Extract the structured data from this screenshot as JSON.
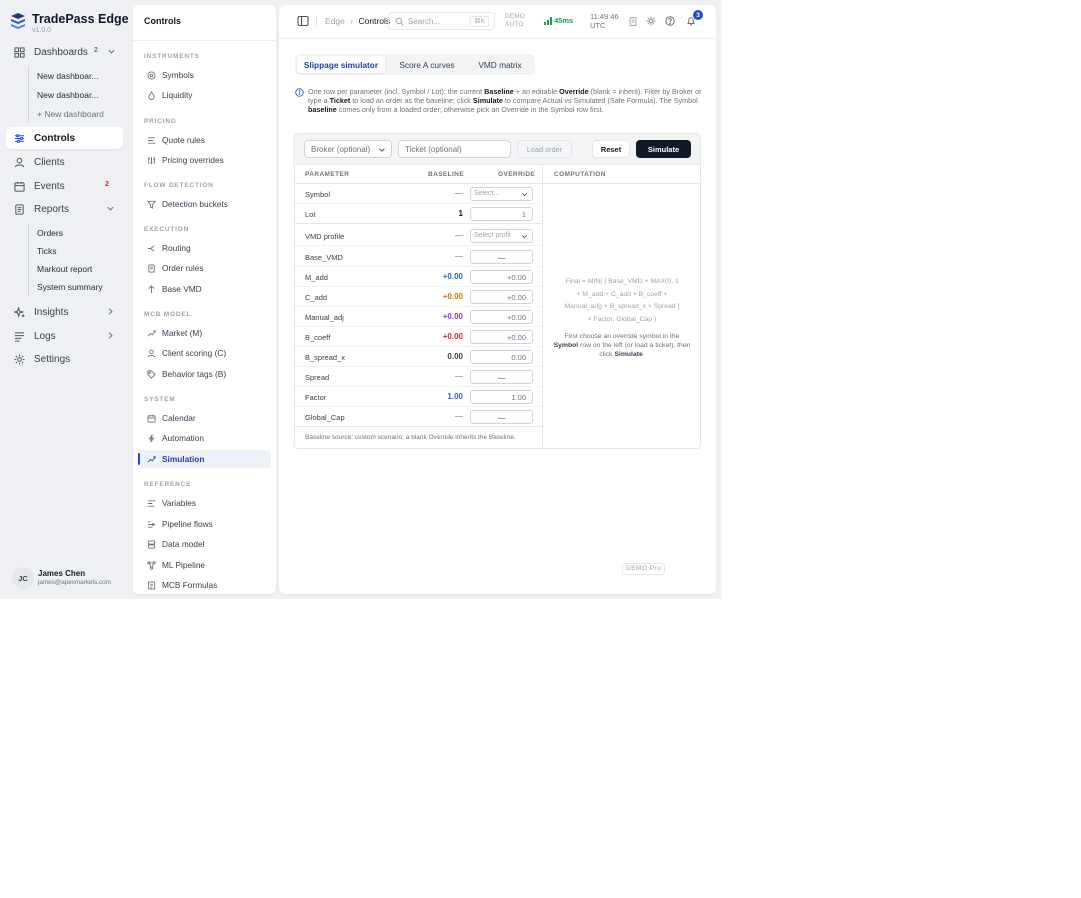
{
  "app": {
    "name": "TradePass Edge",
    "version": "v1.0.0",
    "accent": "#1d4ed8"
  },
  "nav": {
    "dashboards": {
      "label": "Dashboards",
      "count": "2",
      "icon": "grid-icon"
    },
    "dashboard_items": [
      "New dashboar...",
      "New dashboar...",
      "+ New dashboard"
    ],
    "controls": {
      "label": "Controls",
      "icon": "sliders-icon"
    },
    "clients": {
      "label": "Clients",
      "icon": "user-icon"
    },
    "events": {
      "label": "Events",
      "count": "2",
      "icon": "calendar-icon"
    },
    "reports": {
      "label": "Reports",
      "icon": "document-icon"
    },
    "report_items": [
      "Orders",
      "Ticks",
      "Markout report",
      "System summary"
    ],
    "insights": {
      "label": "Insights",
      "icon": "sparkle-icon"
    },
    "logs": {
      "label": "Logs",
      "icon": "list-icon"
    },
    "settings": {
      "label": "Settings",
      "icon": "gear-icon"
    }
  },
  "user": {
    "initials": "JC",
    "name": "James Chen",
    "email": "james@apexmarkets.com"
  },
  "controls_panel": {
    "title": "Controls",
    "sections": {
      "instruments": "INSTRUMENTS",
      "pricing": "PRICING",
      "flow_detection": "FLOW DETECTION",
      "execution": "EXECUTION",
      "mcb_model": "MCB MODEL",
      "system": "SYSTEM",
      "reference": "REFERENCE"
    },
    "items": {
      "symbols": "Symbols",
      "liquidity": "Liquidity",
      "quote_rules": "Quote rules",
      "pricing_overrides": "Pricing overrides",
      "detection_buckets": "Detection buckets",
      "routing": "Routing",
      "order_rules": "Order rules",
      "base_vmd": "Base VMD",
      "market": "Market (M)",
      "client_scoring": "Client scoring (C)",
      "behavior_tags": "Behavior tags (B)",
      "calendar": "Calendar",
      "automation": "Automation",
      "simulation": "Simulation",
      "variables": "Variables",
      "pipeline_flows": "Pipeline flows",
      "data_model": "Data model",
      "ml_pipeline": "ML Pipeline",
      "mcb_formulas": "MCB Formulas"
    }
  },
  "topbar": {
    "crumb_root": "Edge",
    "crumb_sep": "›",
    "crumb_current": "Controls",
    "search_placeholder": "Search...",
    "search_kbd": "⌘K",
    "mode_line1": "DEMO ·",
    "mode_line2": "AUTO",
    "latency": "45ms",
    "time": "11:49:46",
    "timezone": "UTC",
    "notif_count": "3"
  },
  "tabs": [
    "Slippage simulator",
    "Score A curves",
    "VMD matrix"
  ],
  "info": {
    "t1": "One row per parameter (incl. Symbol / Lot): the current ",
    "b1": "Baseline",
    "t2": " + an editable ",
    "b2": "Override",
    "t3": " (blank = inherit). Filter by Broker or type a ",
    "b3": "Ticket",
    "t4": " to load an order as the baseline; click ",
    "b4": "Simulate",
    "t5": " to compare Actual vs Simulated (Safe Formula). The Symbol ",
    "b5": "baseline",
    "t6": " comes only from a loaded order; otherwise pick an Override in the Symbol row first."
  },
  "form": {
    "broker_placeholder": "Broker (optional)",
    "ticket_placeholder": "Ticket (optional)",
    "load_label": "Load order",
    "reset_label": "Reset",
    "simulate_label": "Simulate"
  },
  "table": {
    "headers": {
      "parameter": "PARAMETER",
      "baseline": "BASELINE",
      "override": "OVERRIDE",
      "computation": "COMPUTATION"
    },
    "rows": [
      {
        "name": "Symbol",
        "baseline": "—",
        "override": "Select...",
        "color": "#9ca3af"
      },
      {
        "name": "Lot",
        "baseline": "1",
        "override": "1",
        "color": "#111827"
      },
      {
        "name": "VMD profile",
        "baseline": "—",
        "override": "Select profil",
        "color": "#9ca3af"
      },
      {
        "name": "Base_VMD",
        "baseline": "—",
        "override": "—",
        "color": "#9ca3af"
      },
      {
        "name": "M_add",
        "baseline": "+0.00",
        "override": "+0.00",
        "color": "#2563eb"
      },
      {
        "name": "C_add",
        "baseline": "+0.00",
        "override": "+0.00",
        "color": "#d97706"
      },
      {
        "name": "Manual_adj",
        "baseline": "+0.00",
        "override": "+0.00",
        "color": "#9333ea"
      },
      {
        "name": "B_coeff",
        "baseline": "+0.00",
        "override": "+0.00",
        "color": "#dc2626"
      },
      {
        "name": "B_spread_x",
        "baseline": "0.00",
        "override": "0.00",
        "color": "#374151"
      },
      {
        "name": "Spread",
        "baseline": "—",
        "override": "—",
        "color": "#9ca3af"
      },
      {
        "name": "Factor",
        "baseline": "1.00",
        "override": "1.00",
        "color": "#2563eb"
      },
      {
        "name": "Global_Cap",
        "baseline": "—",
        "override": "—",
        "color": "#9ca3af"
      }
    ],
    "footnote": "Baseline source: custom scenario; a blank Override inherits the Baseline."
  },
  "computation": {
    "formula_lines": [
      "Final = MIN( [ Base_VMD × MAX(0, 1",
      "+ M_add + C_add + B_coeff +",
      "Manual_adj) + B_spread_x × Spread ]",
      "× Factor, Global_Cap )"
    ],
    "hint_t1": "First choose an override symbol in the ",
    "hint_b1": "Symbol",
    "hint_t2": " row on the left (or load a ticket), then click ",
    "hint_b2": "Simulate",
    "hint_t3": "."
  },
  "footer_badge": "DEMO Pro"
}
